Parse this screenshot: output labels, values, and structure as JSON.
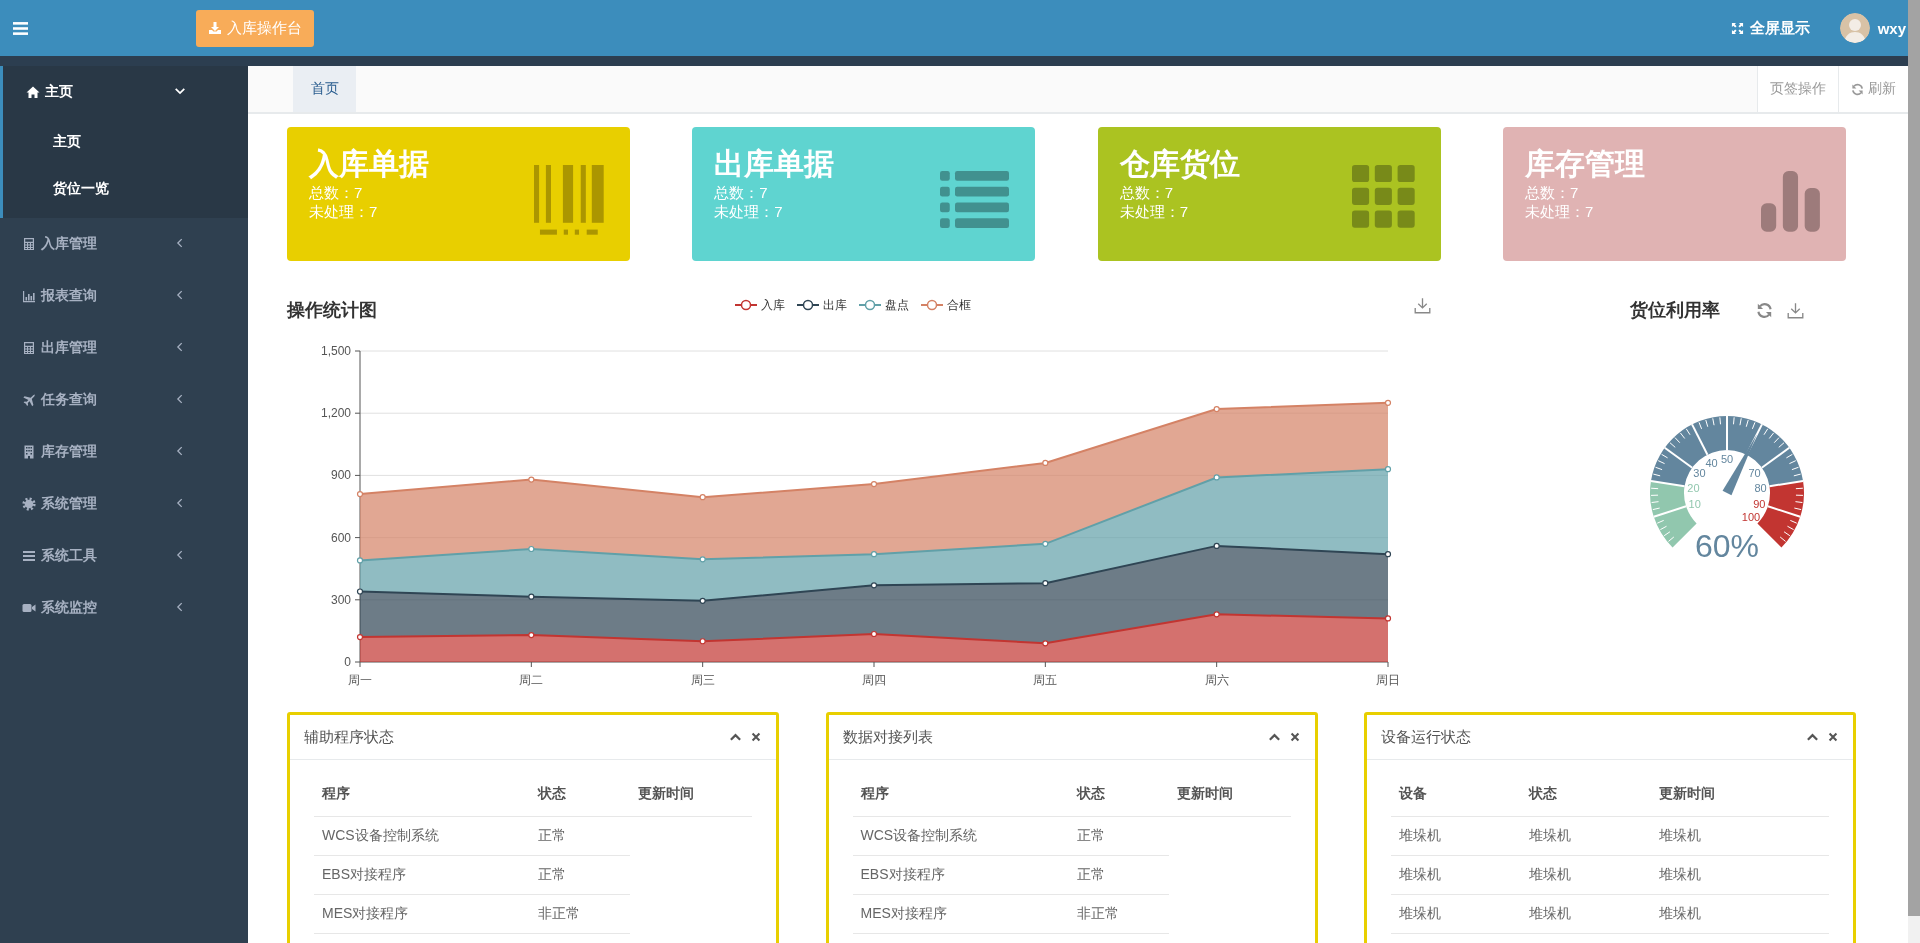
{
  "topbar": {
    "action_button": "入库操作台",
    "fullscreen": "全屏显示",
    "user": "wxy"
  },
  "sidebar": {
    "items": [
      {
        "label": "主页",
        "expanded": true,
        "children": [
          {
            "label": "主页"
          },
          {
            "label": "货位一览"
          }
        ]
      },
      {
        "label": "入库管理",
        "expanded": false
      },
      {
        "label": "报表查询",
        "expanded": false
      },
      {
        "label": "出库管理",
        "expanded": false
      },
      {
        "label": "任务查询",
        "expanded": false
      },
      {
        "label": "库存管理",
        "expanded": false
      },
      {
        "label": "系统管理",
        "expanded": false
      },
      {
        "label": "系统工具",
        "expanded": false
      },
      {
        "label": "系统监控",
        "expanded": false
      }
    ]
  },
  "tabs": [
    {
      "label": "首页",
      "selected": true
    }
  ],
  "tab_actions": [
    {
      "label": "页签操作"
    },
    {
      "label": "刷新"
    }
  ],
  "cards": [
    {
      "title": "入库单据",
      "lines": [
        "总数：7",
        "未处理：7"
      ],
      "color": "#e8cf00"
    },
    {
      "title": "出库单据",
      "lines": [
        "总数：7",
        "未处理：7"
      ],
      "color": "#5fd4d0"
    },
    {
      "title": "仓库货位",
      "lines": [
        "总数：7",
        "未处理：7"
      ],
      "color": "#abc321"
    },
    {
      "title": "库存管理",
      "lines": [
        "总数：7",
        "未处理：7"
      ],
      "color": "#e0b3b3"
    }
  ],
  "chart": {
    "title": "操作统计图",
    "chart_data": {
      "type": "area",
      "stacked": true,
      "categories": [
        "周一",
        "周二",
        "周三",
        "周四",
        "周五",
        "周六",
        "周日"
      ],
      "series": [
        {
          "name": "入库",
          "color": "#c23531",
          "values": [
            120,
            130,
            100,
            135,
            90,
            230,
            210
          ]
        },
        {
          "name": "出库",
          "color": "#2f4554",
          "values": [
            220,
            185,
            195,
            235,
            290,
            330,
            310
          ]
        },
        {
          "name": "盘点",
          "color": "#61a0a8",
          "values": [
            150,
            230,
            200,
            150,
            190,
            330,
            410
          ]
        },
        {
          "name": "合框",
          "color": "#d48265",
          "values": [
            320,
            335,
            300,
            338,
            390,
            330,
            320
          ]
        }
      ],
      "ylim": [
        0,
        1500
      ],
      "grid": true,
      "yticks": [
        {
          "value": 0,
          "label": "0"
        },
        {
          "value": 300,
          "label": "300"
        },
        {
          "value": 600,
          "label": "600"
        },
        {
          "value": 900,
          "label": "900"
        },
        {
          "value": 1200,
          "label": "1,200"
        },
        {
          "value": 1500,
          "label": "1,500"
        }
      ]
    }
  },
  "gauge": {
    "title": "货位利用率",
    "level": 0.6,
    "reading": "60%",
    "tick_labels": [
      "50",
      "40",
      "30",
      "70",
      "20",
      "80",
      "10",
      "90",
      "100"
    ]
  },
  "panels": [
    {
      "title": "辅助程序状态",
      "columns": [
        "程序",
        "状态",
        "更新时间"
      ],
      "rows": [
        [
          "WCS设备控制系统",
          "正常"
        ],
        [
          "EBS对接程序",
          "正常"
        ],
        [
          "MES对接程序",
          "非正常"
        ]
      ]
    },
    {
      "title": "数据对接列表",
      "columns": [
        "程序",
        "状态",
        "更新时间"
      ],
      "rows": [
        [
          "WCS设备控制系统",
          "正常"
        ],
        [
          "EBS对接程序",
          "正常"
        ],
        [
          "MES对接程序",
          "非正常"
        ]
      ]
    },
    {
      "title": "设备运行状态",
      "columns": [
        "设备",
        "状态",
        "更新时间"
      ],
      "rows": [
        [
          "堆垛机",
          "堆垛机",
          "堆垛机"
        ],
        [
          "堆垛机",
          "堆垛机",
          "堆垛机"
        ],
        [
          "堆垛机",
          "堆垛机",
          "堆垛机"
        ]
      ]
    }
  ]
}
